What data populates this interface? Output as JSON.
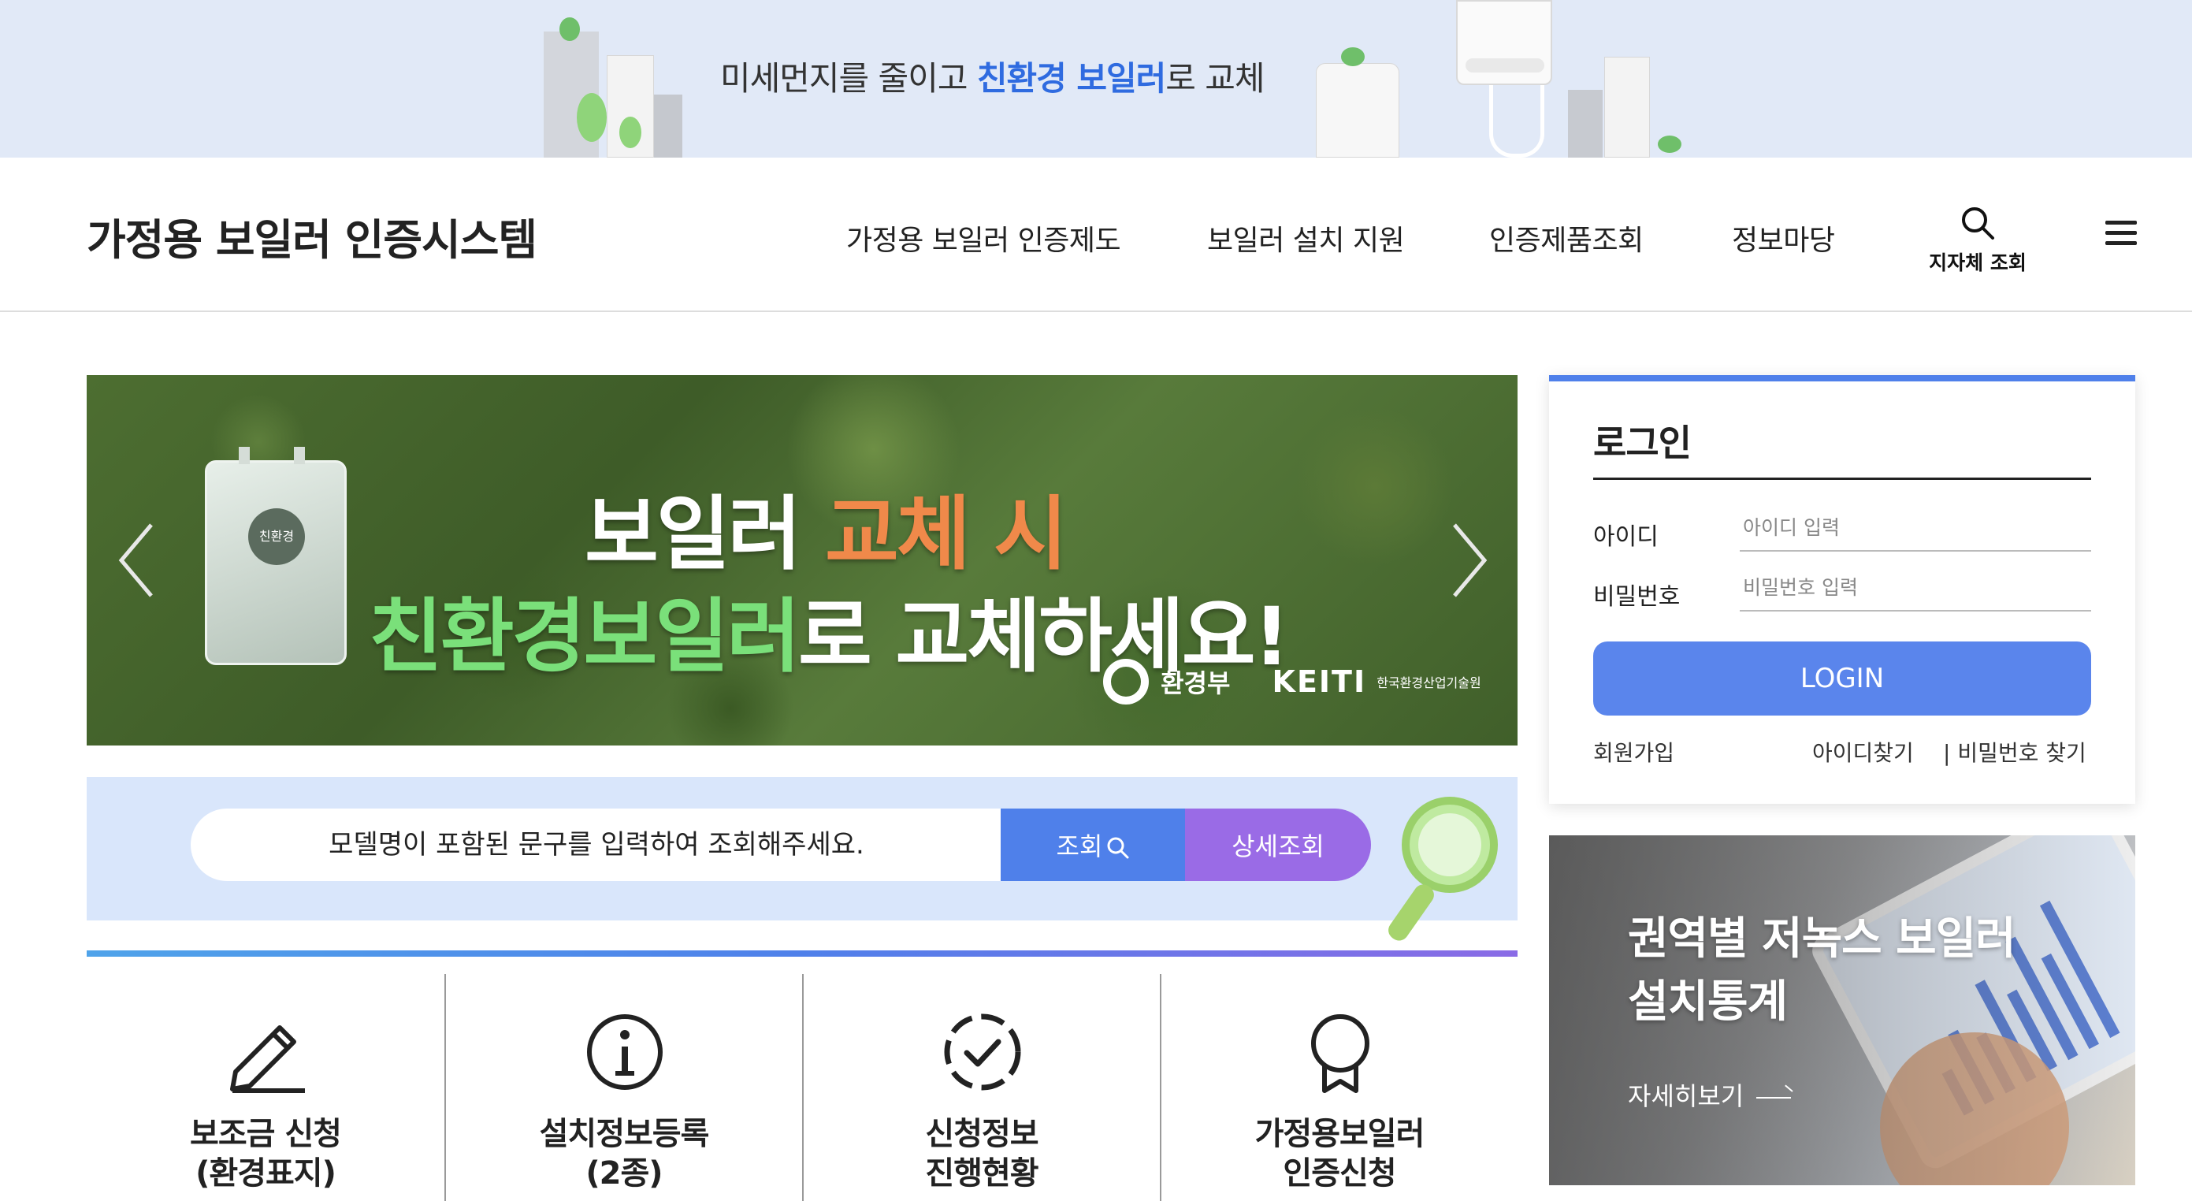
{
  "top_banner": {
    "slogan_part1": "미세먼지를 줄이고 ",
    "slogan_highlight": "친환경 보일러",
    "slogan_part2": "로 교체"
  },
  "header": {
    "site_title": "가정용 보일러 인증시스템",
    "nav": [
      {
        "label": "가정용 보일러 인증제도"
      },
      {
        "label": "보일러 설치 지원"
      },
      {
        "label": "인증제품조회"
      },
      {
        "label": "정보마당"
      }
    ],
    "local_search_label": "지자체 조회",
    "local_search_icon": "search-icon",
    "menu_icon": "hamburger-menu-icon"
  },
  "hero": {
    "line1_white": "보일러 ",
    "line1_orange": "교체 시",
    "line2_green": "친환경보일러",
    "line2_white": "로 교체하세요!",
    "boiler_badge": "친환경",
    "ministry_logo_text": "환경부",
    "institute_logo_text": "KEITI",
    "institute_logo_sub": "한국환경산업기술원",
    "prev_icon": "chevron-left-icon",
    "next_icon": "chevron-right-icon"
  },
  "search": {
    "placeholder": "모델명이 포함된 문구를 입력하여 조회해주세요.",
    "search_button": "조회",
    "detail_search_button": "상세조회"
  },
  "quick_links": [
    {
      "label": "보조금 신청\n(환경표지)",
      "icon": "pencil-icon"
    },
    {
      "label": "설치정보등록\n(2종)",
      "icon": "info-icon"
    },
    {
      "label": "신청정보\n진행현황",
      "icon": "check-circle-icon"
    },
    {
      "label": "가정용보일러\n인증신청",
      "icon": "award-badge-icon"
    }
  ],
  "login": {
    "title": "로그인",
    "id_label": "아이디",
    "id_placeholder": "아이디 입력",
    "pw_label": "비밀번호",
    "pw_placeholder": "비밀번호 입력",
    "login_button": "LOGIN",
    "signup_link": "회원가입",
    "find_id_link": "아이디찾기",
    "find_pw_link": "| 비밀번호 찾기"
  },
  "stats_card": {
    "title": "권역별 저녹스 보일러\n설치통계",
    "more_link": "자세히보기"
  },
  "colors": {
    "accent_blue": "#4f80ea",
    "accent_purple": "#9a6be6",
    "banner_bg": "#e1e9f7",
    "search_bg": "#d9e6fb",
    "hero_orange": "#f0894a",
    "hero_green": "#7ae07a"
  }
}
